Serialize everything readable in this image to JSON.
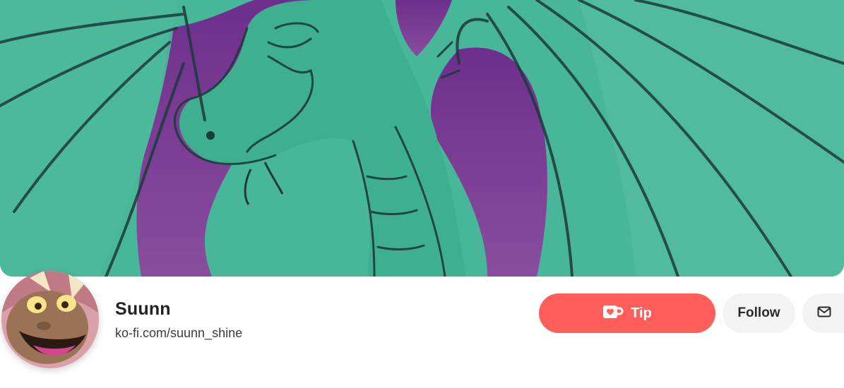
{
  "banner": {
    "image_name": "dragon-banner-image",
    "colors": {
      "teal": "#3fb595",
      "purple": "#7b3f93",
      "line": "#1d3a3c"
    }
  },
  "profile": {
    "avatar_name": "creator-avatar",
    "name": "Suunn",
    "url": "ko-fi.com/suunn_shine"
  },
  "actions": {
    "tip": {
      "label": "Tip",
      "icon": "coffee-cup-heart-icon",
      "color": "#ff5e5b"
    },
    "follow": {
      "label": "Follow"
    },
    "message": {
      "icon": "envelope-icon"
    }
  }
}
